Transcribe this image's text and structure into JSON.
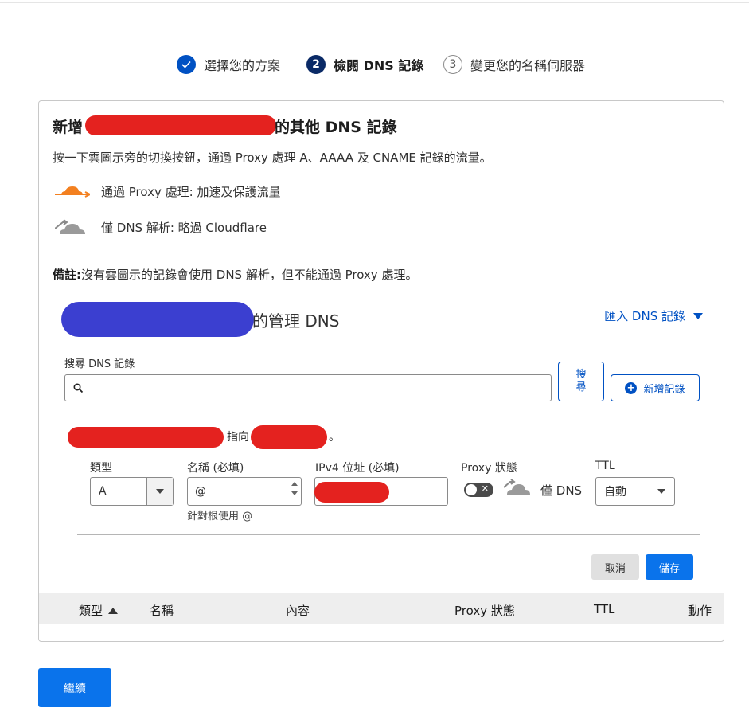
{
  "stepper": [
    {
      "number": "✓",
      "label": "選擇您的方案",
      "state": "done"
    },
    {
      "number": "2",
      "label": "檢閱 DNS 記錄",
      "state": "active"
    },
    {
      "number": "3",
      "label": "變更您的名稱伺服器",
      "state": "todo"
    }
  ],
  "card": {
    "title_prefix": "新增",
    "title_suffix": "的其他 DNS 記錄",
    "description": "按一下雲圖示旁的切換按鈕，通過 Proxy 處理 A、AAAA 及 CNAME 記錄的流量。",
    "legend": {
      "proxied_label": "通過 Proxy 處理: 加速及保護流量",
      "dns_only_label": "僅 DNS 解析: 略過 Cloudflare"
    },
    "note_bold": "備註:",
    "note_text": "沒有雲圖示的記錄會使用 DNS 解析，但不能通過 Proxy 處理。"
  },
  "dns_section": {
    "title_suffix": "的管理 DNS",
    "import_label": "匯入 DNS 記錄"
  },
  "search": {
    "label": "搜尋 DNS 記錄",
    "value": "",
    "button_label": "搜\n尋"
  },
  "add_record_label": "新增記錄",
  "record_form": {
    "points_to": "指向",
    "period": "。",
    "type_label": "類型",
    "type_value": "A",
    "name_label": "名稱 (必填)",
    "name_value": "@",
    "name_help": "針對根使用 @",
    "ipv4_label": "IPv4 位址 (必填)",
    "proxy_label": "Proxy 狀態",
    "proxy_state": "僅 DNS",
    "ttl_label": "TTL",
    "ttl_value": "自動",
    "cancel_label": "取消",
    "save_label": "儲存"
  },
  "table_headers": [
    "類型",
    "名稱",
    "內容",
    "Proxy 狀態",
    "TTL",
    "動作"
  ],
  "continue_label": "繼續",
  "colors": {
    "accent": "#0051c3",
    "primary_button": "#0a73eb",
    "proxy_orange": "#f38020"
  }
}
